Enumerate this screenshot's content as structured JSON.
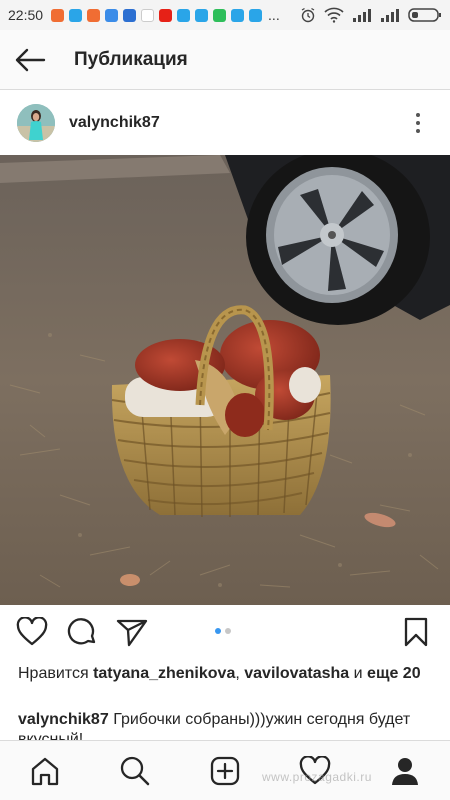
{
  "status_bar": {
    "time": "22:50",
    "notification_icons": [
      "mail-icon",
      "browser-icon",
      "mail-icon",
      "cloud-icon",
      "vpn-icon",
      "google-icon",
      "youtube-icon",
      "browser-icon",
      "browser-icon",
      "whatsapp-icon",
      "browser-icon",
      "browser-icon"
    ],
    "notification_colors": [
      "#f06d33",
      "#2aa5e8",
      "#f06d33",
      "#3b8ce8",
      "#2c6fd1",
      "#ffffff",
      "#e62117",
      "#2aa5e8",
      "#2aa5e8",
      "#2ebe5a",
      "#2aa5e8",
      "#2aa5e8"
    ],
    "more": "..."
  },
  "header": {
    "title": "Публикация"
  },
  "post": {
    "username": "valynchik87",
    "likes_prefix": "Нравится",
    "likes_user1": "tatyana_zhenikova",
    "likes_sep": ",",
    "likes_user2": "vavilovatasha",
    "likes_and": "и",
    "likes_more": "еще 20",
    "caption_user": "valynchik87",
    "caption_text": "Грибочки собраны)))ужин сегодня будет вкусный!"
  },
  "carousel": {
    "count": 2,
    "active_index": 0,
    "active_color": "#3897f0",
    "inactive_color": "#c7c7c7"
  },
  "watermark": "www.prozagadki.ru",
  "colors": {
    "text": "#262626",
    "border": "#dbdbdb",
    "header_bg": "#fafafa"
  }
}
